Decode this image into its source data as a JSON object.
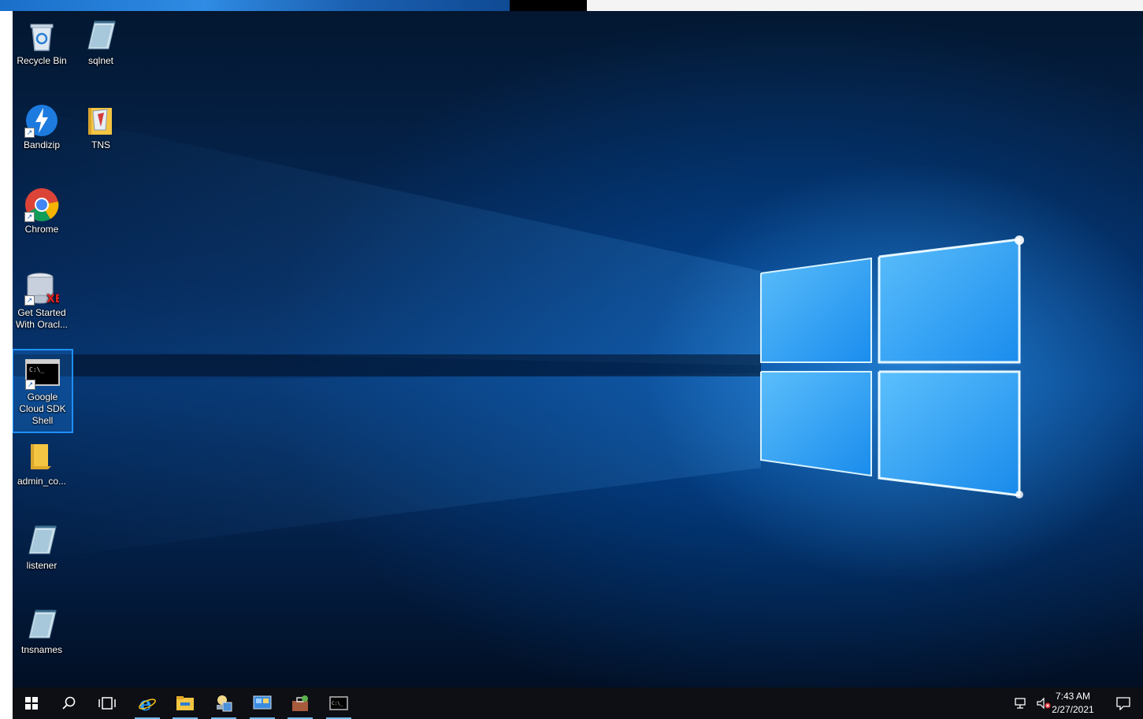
{
  "desktop_icons": [
    {
      "label": "Recycle Bin",
      "icon": "recycle-bin-icon"
    },
    {
      "label": "sqlnet",
      "icon": "notepad-file-icon"
    },
    {
      "label": "Bandizip",
      "icon": "bandizip-icon"
    },
    {
      "label": "TNS",
      "icon": "folder-icon"
    },
    {
      "label": "Chrome",
      "icon": "chrome-icon"
    },
    {
      "label": "Get Started With Oracl...",
      "icon": "oracle-xe-icon"
    },
    {
      "label": "Google Cloud SDK Shell",
      "icon": "cmd-shell-icon",
      "selected": true
    },
    {
      "label": "admin_co...",
      "icon": "folder-icon"
    },
    {
      "label": "listener",
      "icon": "notepad-file-icon"
    },
    {
      "label": "tnsnames",
      "icon": "notepad-file-icon"
    }
  ],
  "taskbar": {
    "items": [
      {
        "name": "start",
        "icon": "windows-logo-icon"
      },
      {
        "name": "search",
        "icon": "search-icon"
      },
      {
        "name": "task-view",
        "icon": "task-view-icon"
      },
      {
        "name": "internet-explorer",
        "icon": "internet-explorer-icon"
      },
      {
        "name": "file-explorer",
        "icon": "file-explorer-icon"
      },
      {
        "name": "server-manager",
        "icon": "server-manager-icon"
      },
      {
        "name": "control-panel",
        "icon": "control-panel-icon"
      },
      {
        "name": "toolbox",
        "icon": "toolbox-icon"
      },
      {
        "name": "command-prompt",
        "icon": "cmd-shell-icon"
      }
    ],
    "tray": {
      "network_icon": "network-icon",
      "volume_icon": "volume-muted-icon",
      "time": "7:43 AM",
      "date": "2/27/2021",
      "notification_icon": "action-center-icon"
    }
  },
  "colors": {
    "selection_outline": "#1e90ff",
    "taskbar_bg": "#0d0f14",
    "accent": "#76b9ed"
  }
}
